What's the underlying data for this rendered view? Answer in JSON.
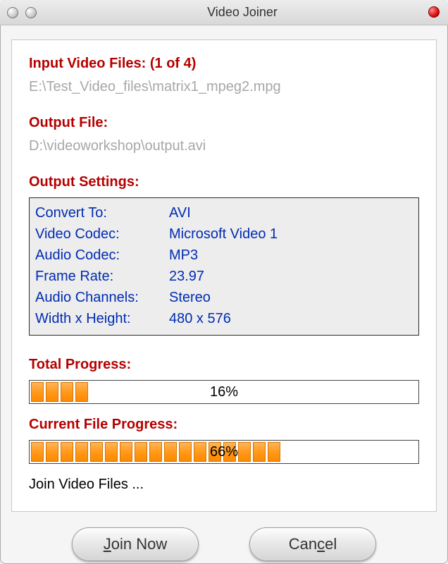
{
  "window": {
    "title": "Video Joiner"
  },
  "input": {
    "heading": "Input Video Files:",
    "count": "(1 of 4)",
    "path": "E:\\Test_Video_files\\matrix1_mpeg2.mpg"
  },
  "output": {
    "heading": "Output File:",
    "path": "D:\\videoworkshop\\output.avi"
  },
  "settings": {
    "heading": "Output Settings:",
    "rows": [
      {
        "k": "Convert To:",
        "v": "AVI"
      },
      {
        "k": "Video Codec:",
        "v": "Microsoft Video 1"
      },
      {
        "k": "Audio Codec:",
        "v": "MP3"
      },
      {
        "k": "Frame Rate:",
        "v": "23.97"
      },
      {
        "k": "Audio Channels:",
        "v": "Stereo"
      },
      {
        "k": "Width x Height:",
        "v": "480 x 576"
      }
    ]
  },
  "progress": {
    "total": {
      "heading": "Total Progress:",
      "pct_text": "16%",
      "pct": 16
    },
    "current": {
      "heading": "Current File Progress:",
      "pct_text": "66%",
      "pct": 66
    }
  },
  "status": "Join Video Files ...",
  "buttons": {
    "join_pre": "J",
    "join_post": "oin Now",
    "cancel_pre": "Can",
    "cancel_mid": "c",
    "cancel_post": "el"
  }
}
